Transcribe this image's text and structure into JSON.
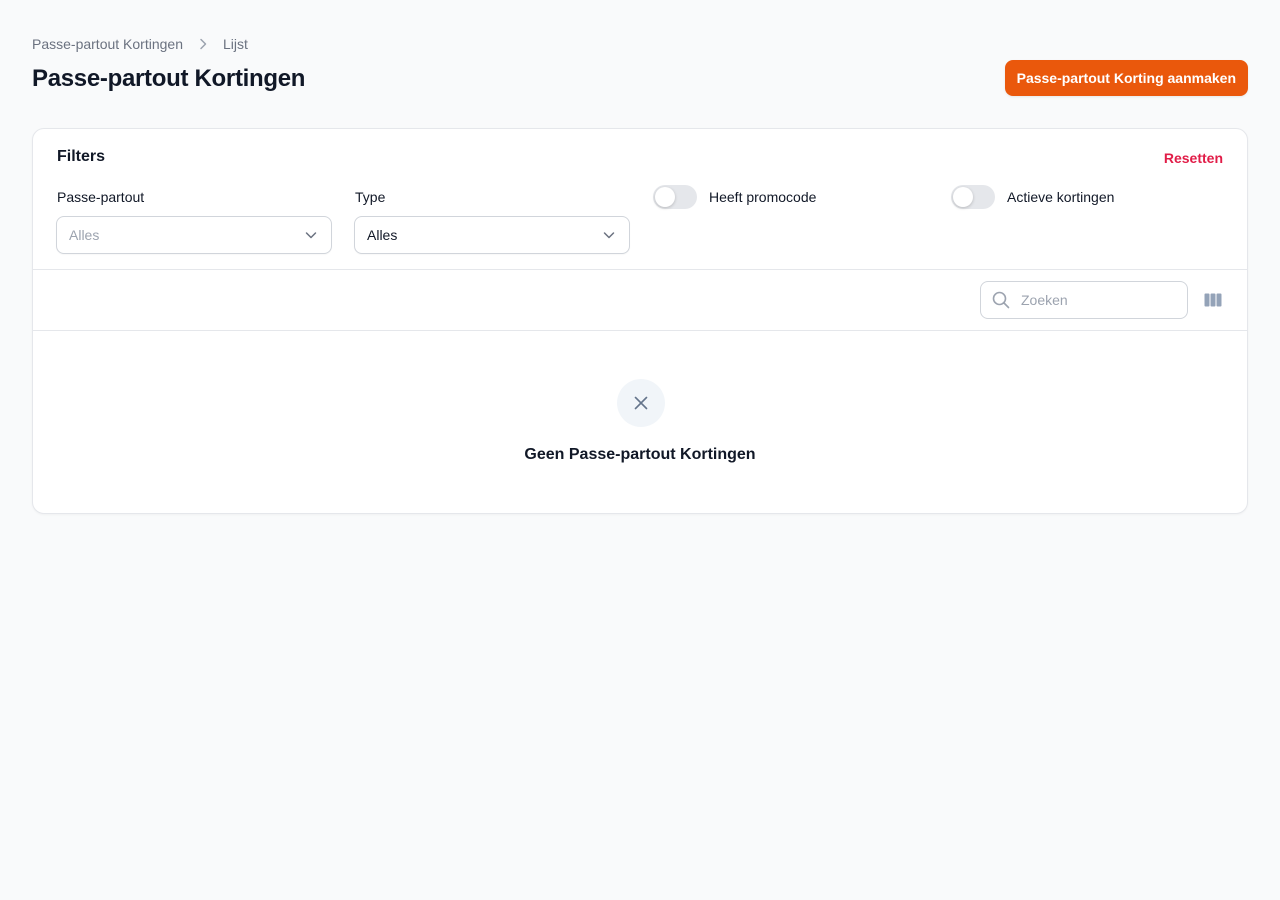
{
  "breadcrumb": {
    "items": [
      "Passe-partout Kortingen",
      "Lijst"
    ]
  },
  "header": {
    "title": "Passe-partout Kortingen",
    "create_label": "Passe-partout Korting aanmaken",
    "accent_color": "#ea580c"
  },
  "filters": {
    "heading": "Filters",
    "reset_label": "Resetten",
    "reset_color": "#e11d48",
    "passe_partout": {
      "label": "Passe-partout",
      "value": "Alles"
    },
    "type": {
      "label": "Type",
      "value": "Alles"
    },
    "has_promocode": {
      "label": "Heeft promocode",
      "on": false
    },
    "active_discounts": {
      "label": "Actieve kortingen",
      "on": false
    }
  },
  "toolbar": {
    "search_placeholder": "Zoeken",
    "search_icon": "search-icon",
    "columns_icon": "columns-icon"
  },
  "empty_state": {
    "icon": "x-icon",
    "heading": "Geen Passe-partout Kortingen"
  }
}
